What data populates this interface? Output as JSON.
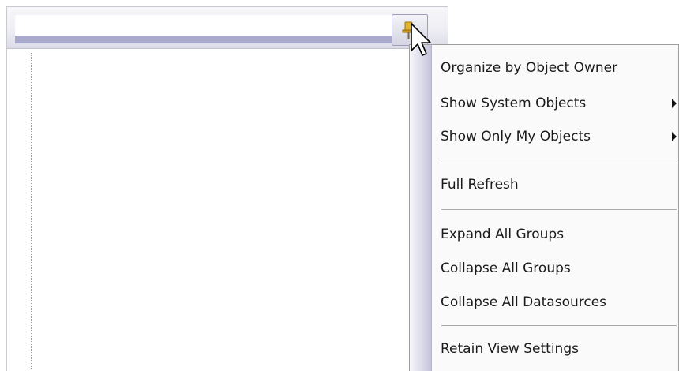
{
  "menu": {
    "items": [
      {
        "label": "Organize by Object Owner",
        "submenu": false
      },
      {
        "label": "Show System Objects",
        "submenu": true
      },
      {
        "label": "Show Only My Objects",
        "submenu": true
      },
      {
        "label": "Full Refresh",
        "submenu": false
      },
      {
        "label": "Expand All Groups",
        "submenu": false
      },
      {
        "label": "Collapse All Groups",
        "submenu": false
      },
      {
        "label": "Collapse All Datasources",
        "submenu": false
      },
      {
        "label": "Retain View Settings",
        "submenu": false
      }
    ]
  },
  "toolbar": {
    "pin_icon": "pin-icon"
  },
  "colors": {
    "menu_background": "#fafafa",
    "gutter": "#d9d9e9",
    "toolbar": "#eeeef4",
    "pin": "#e3b62b"
  }
}
